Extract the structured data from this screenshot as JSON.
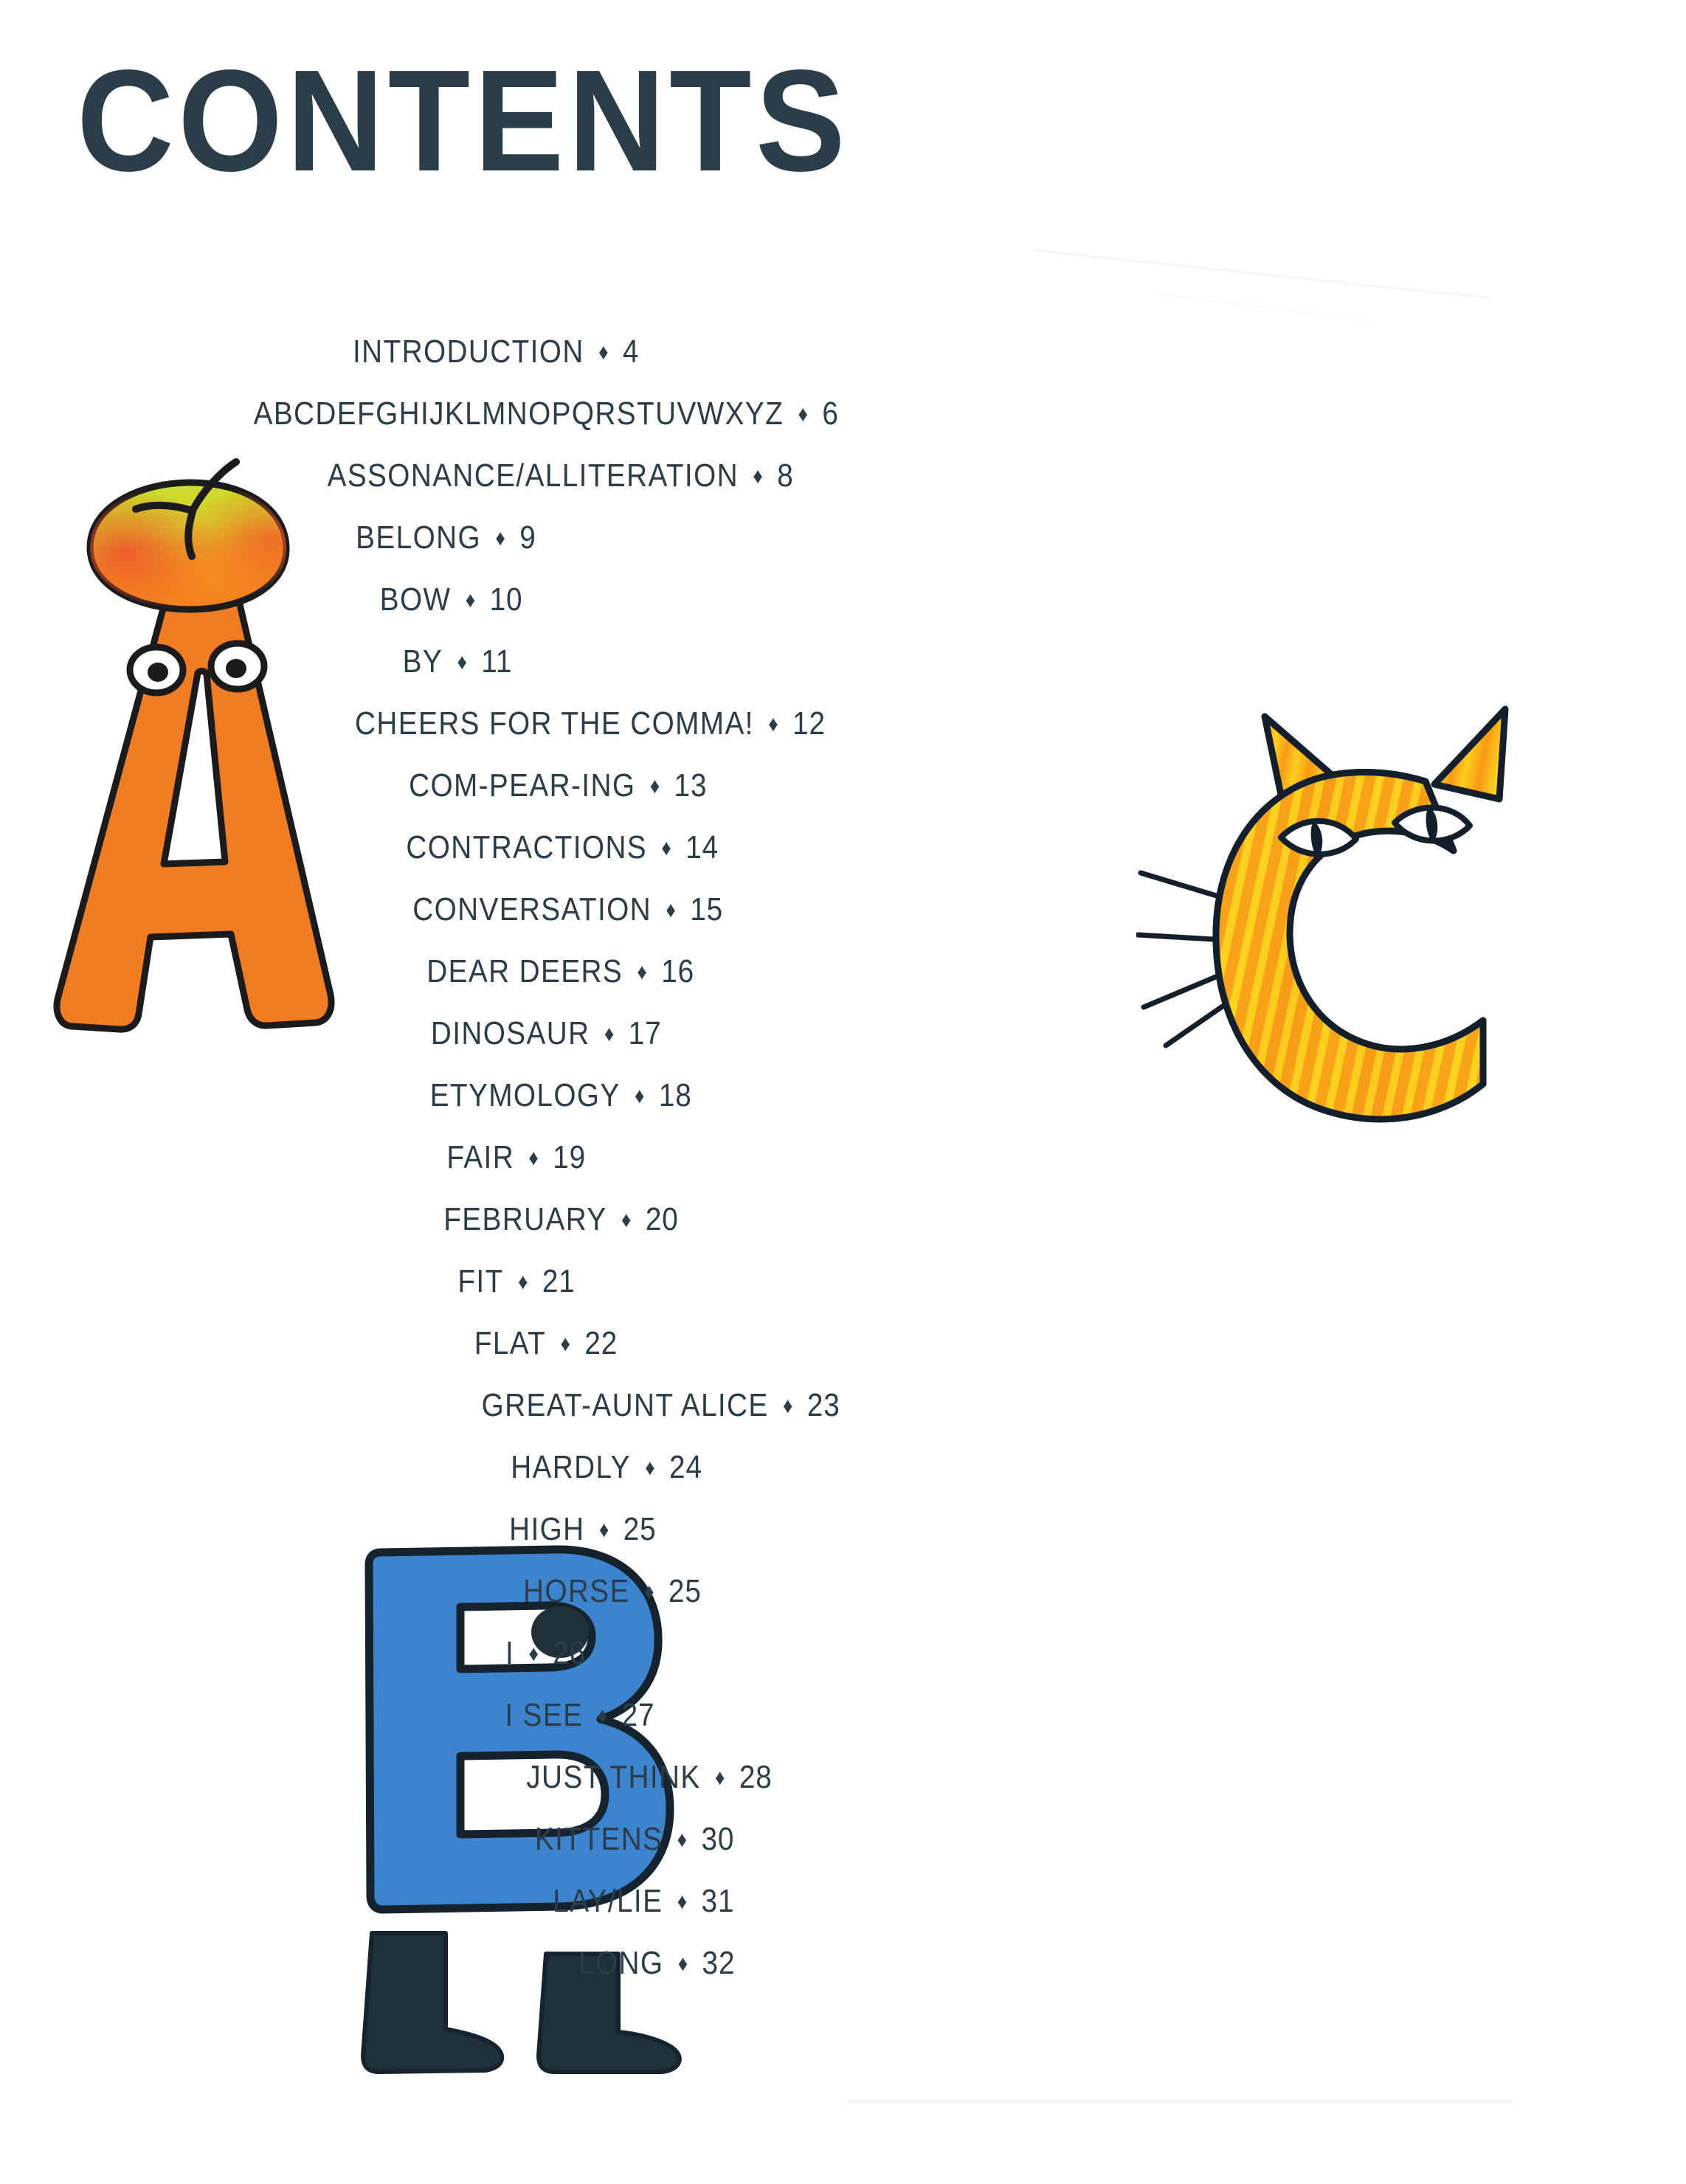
{
  "page": {
    "title": "CONTENTS",
    "separator": "♦",
    "text_color": "#2c3d4a",
    "background": "#ffffff"
  },
  "toc": {
    "entries": [
      {
        "label": "INTRODUCTION",
        "page": "4"
      },
      {
        "label": "ABCDEFGHIJKLMNOPQRSTUVWXYZ",
        "page": "6"
      },
      {
        "label": "ASSONANCE/ALLITERATION",
        "page": "8"
      },
      {
        "label": "BELONG",
        "page": "9"
      },
      {
        "label": "BOW",
        "page": "10"
      },
      {
        "label": "BY",
        "page": "11"
      },
      {
        "label": "CHEERS FOR THE COMMA!",
        "page": "12"
      },
      {
        "label": "COM-PEAR-ING",
        "page": "13"
      },
      {
        "label": "CONTRACTIONS",
        "page": "14"
      },
      {
        "label": "CONVERSATION",
        "page": "15"
      },
      {
        "label": "DEAR DEERS",
        "page": "16"
      },
      {
        "label": "DINOSAUR",
        "page": "17"
      },
      {
        "label": "ETYMOLOGY",
        "page": "18"
      },
      {
        "label": "FAIR",
        "page": "19"
      },
      {
        "label": "FEBRUARY",
        "page": "20"
      },
      {
        "label": "FIT",
        "page": "21"
      },
      {
        "label": "FLAT",
        "page": "22"
      },
      {
        "label": "GREAT-AUNT ALICE",
        "page": "23"
      },
      {
        "label": "HARDLY",
        "page": "24"
      },
      {
        "label": "HIGH",
        "page": "25"
      },
      {
        "label": "HORSE",
        "page": "25"
      },
      {
        "label": "I",
        "page": "26"
      },
      {
        "label": "I SEE",
        "page": "27"
      },
      {
        "label": "JUST THINK",
        "page": "28"
      },
      {
        "label": "KITTENS",
        "page": "30"
      },
      {
        "label": "LAY/LIE",
        "page": "31"
      },
      {
        "label": "LONG",
        "page": "32"
      }
    ]
  },
  "illustrations": {
    "letter_a": {
      "letter": "A",
      "description": "orange letter A with two googly eyes, apple balanced on top",
      "body_color": "#f07d22",
      "outline_color": "#1b1b1b",
      "fruit_top_color": "#b9d72e",
      "fruit_bottom_color": "#f4901e",
      "fruit_edge_color": "#ef4a2a"
    },
    "letter_c": {
      "letter": "C",
      "description": "orange tabby cat shaped like a letter C with ears and whiskers",
      "body_color": "#f7a31b",
      "stripe_color": "#ffd21e",
      "outline_color": "#13202b"
    },
    "letter_b": {
      "letter": "B",
      "description": "blue letter B with an eye dot, wearing dark boots",
      "body_color": "#3d84ce",
      "outline_color": "#14232e",
      "boot_color": "#1f3038"
    }
  }
}
